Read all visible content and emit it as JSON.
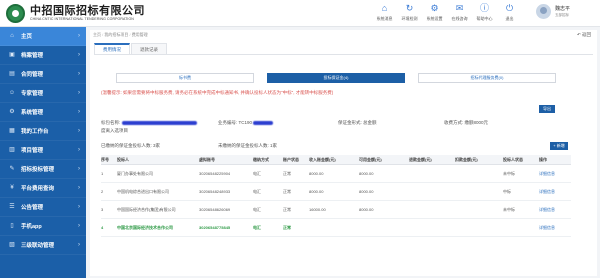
{
  "header": {
    "logo_cn": "中招国际招标有限公司",
    "logo_en": "CHINA CNTIC INTERNATIONAL TENDERING CORPORATION",
    "nav": [
      {
        "icon": "home-icon",
        "glyph": "⌂",
        "label": "系统消息"
      },
      {
        "icon": "refresh-icon",
        "glyph": "↻",
        "label": "环境检测"
      },
      {
        "icon": "gear-icon",
        "glyph": "⚙",
        "label": "系统设置"
      },
      {
        "icon": "mail-icon",
        "glyph": "✉",
        "label": "在线咨询"
      },
      {
        "icon": "info-icon",
        "glyph": "ⓘ",
        "label": "帮助中心"
      },
      {
        "icon": "power-icon",
        "glyph": "⏻",
        "label": "退出"
      }
    ],
    "user_name": "魏志平",
    "user_role": "五部招标"
  },
  "sidebar": {
    "items": [
      {
        "label": "主页",
        "icon": "⌂"
      },
      {
        "label": "档案管理",
        "icon": "▣"
      },
      {
        "label": "合同管理",
        "icon": "▤"
      },
      {
        "label": "专家管理",
        "icon": "☺"
      },
      {
        "label": "系统管理",
        "icon": "⚙"
      },
      {
        "label": "我的工作台",
        "icon": "▦"
      },
      {
        "label": "项目管理",
        "icon": "▥"
      },
      {
        "label": "招标投标管理",
        "icon": "✎"
      },
      {
        "label": "平台费用查询",
        "icon": "¥"
      },
      {
        "label": "公告管理",
        "icon": "☰"
      },
      {
        "label": "手机app",
        "icon": "▯"
      },
      {
        "label": "三级联动管理",
        "icon": "▧"
      }
    ]
  },
  "breadcrumb": [
    "主页",
    "我的招标项目",
    "费用管理"
  ],
  "back_label": "返回",
  "tabs": [
    "费用情况",
    "退款记录"
  ],
  "segments": [
    "标书费",
    "投标保证金(4)",
    "招标代理服务费(0)"
  ],
  "notice": "(温馨提示: 如果您需要将中标服务费, 请务必在系统中完成中标通知书, 并确认投标人状态为\"中标\", 才能转中标服务费)",
  "export_label": "导出",
  "info": {
    "package_label": "标包名称:",
    "package_value": "度离入选项目",
    "business_label": "业务编号:",
    "business_value": "TC190",
    "deposit_type_label": "保证金形式:",
    "deposit_type_value": "总金额",
    "amount_label": "收费方式:",
    "amount_value": "缴额8000元"
  },
  "stats": {
    "paid_label": "已缴纳的保证金投标人数:",
    "paid_value": "3家",
    "unpaid_label": "未缴纳的保证金投标人数:",
    "unpaid_value": "1家"
  },
  "add_label": "+ 新增",
  "table": {
    "headers": [
      "序号",
      "投标人",
      "虚拟账号",
      "缴纳方式",
      "账户状态",
      "收入账金额(元)",
      "可用金额(元)",
      "退款金额(元)",
      "扣款金额(元)",
      "投标人状态",
      "操作"
    ],
    "rows": [
      {
        "cells": [
          "1",
          "厦门办事处有限公司",
          "30206548225904",
          "电汇",
          "正常",
          "8000.00",
          "8000.00",
          "",
          "",
          "未中标",
          "详细信息"
        ],
        "green": false
      },
      {
        "cells": [
          "2",
          "中国机电综合进出口有限公司",
          "30206548248933",
          "电汇",
          "正常",
          "8000.00",
          "8000.00",
          "",
          "",
          "中标",
          "详细信息"
        ],
        "green": false
      },
      {
        "cells": [
          "3",
          "中国国际经济合作(集团)有限公司",
          "30206548626069",
          "电汇",
          "正常",
          "16000.00",
          "8000.00",
          "",
          "",
          "未中标",
          "详细信息"
        ],
        "green": false
      },
      {
        "cells": [
          "4",
          "中国北京国际经济技术合作公司",
          "30206548775845",
          "电汇",
          "正常",
          "",
          "",
          "",
          "",
          "",
          "详细信息"
        ],
        "green": true
      }
    ]
  },
  "colors": {
    "sidebar": "#1b5fa8",
    "sidebar_active": "#3a86d9",
    "primary": "#1d5fa6",
    "notice": "#d9534f",
    "green_row": "#2e9a46"
  }
}
